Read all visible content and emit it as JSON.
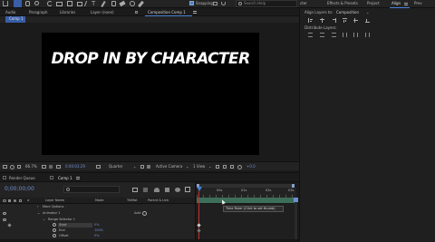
{
  "toolbar": {
    "snapping_label": "Snapping",
    "search_placeholder": "Search Help"
  },
  "top_panels": {
    "audio": "Audio",
    "paragraph": "Paragraph",
    "libraries": "Libraries",
    "layer_none": "Layer (none)",
    "composition": "Composition Comp 1",
    "comp_tab": "Comp 1"
  },
  "right_panel_tabs": [
    "cter",
    "Effects & Presets",
    "Project",
    "Align",
    "Prev"
  ],
  "align": {
    "align_to_label": "Align Layers to:",
    "align_to_value": "Composition",
    "distribute_label": "Distribute Layers:"
  },
  "comp": {
    "title_text": "DROP IN BY CHARACTER"
  },
  "viewer_bar": {
    "zoom": "66.7%",
    "timecode": "0:00:03:29",
    "resolution": "Quarter",
    "camera": "Active Camera",
    "views": "1 View",
    "exposure": "+0.0"
  },
  "timeline": {
    "render_queue": "Render Queue",
    "comp_tab": "Comp 1",
    "timecode": "0;00;00;00",
    "col_layer_name": "Layer Name",
    "col_mode": "Mode",
    "col_trkmat": "TrkMat",
    "col_parent": "Parent & Link",
    "rows": [
      {
        "name": "More Options"
      },
      {
        "name": "Animator 1",
        "add": "Add:"
      },
      {
        "name": "Range Selector 1"
      },
      {
        "name": "Start",
        "value": "0%"
      },
      {
        "name": "End",
        "value": "100%"
      },
      {
        "name": "Offset",
        "value": "0%"
      }
    ],
    "ruler_labels": [
      "00s",
      "01s",
      "02s",
      "03s"
    ],
    "tooltip": "Time Ruler (Click to set thumb)"
  }
}
